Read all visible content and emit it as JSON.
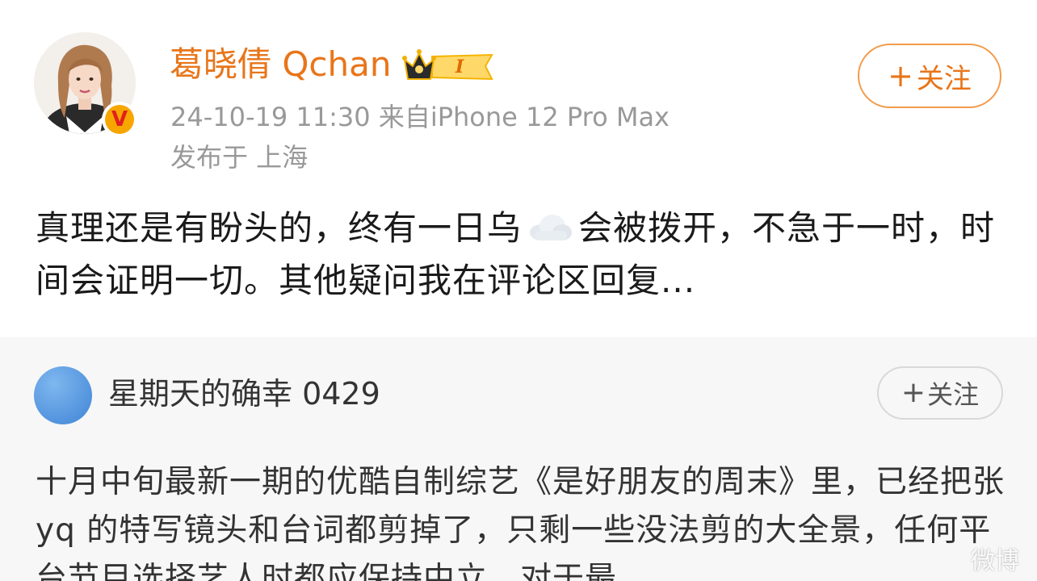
{
  "post": {
    "author": {
      "name": "葛晓倩 Qchan",
      "member_level": "I",
      "verified_badge_letter": "V",
      "avatar_icon": "user-avatar-photo"
    },
    "meta": {
      "timestamp_device": "24-10-19 11:30  来自iPhone 12 Pro Max",
      "location": "发布于 上海"
    },
    "follow_button": {
      "plus": "+",
      "label": "关注"
    },
    "text_before_emoji": "真理还是有盼头的，终有一日乌",
    "emoji": "cloud-emoji",
    "text_after_emoji": "会被拨开，不急于一时，时间会证明一切。其他疑问我在评论区回复..."
  },
  "repost": {
    "author": {
      "name": "星期天的确幸 0429",
      "avatar_icon": "blue-circle-avatar"
    },
    "follow_button": {
      "plus": "+",
      "label": "关注"
    },
    "text": "十月中旬最新一期的优酷自制综艺《是好朋友的周末》里，已经把张 yq 的特写镜头和台词都剪掉了，只剩一些没法剪的大全景，任何平台节目选择艺人时都应保持中立，对于最"
  },
  "watermark": {
    "text": "微博"
  },
  "colors": {
    "username_orange": "#e8751a",
    "follow_border": "#f29a4a",
    "meta_gray": "#999999",
    "repost_bg": "#f7f7f7"
  }
}
